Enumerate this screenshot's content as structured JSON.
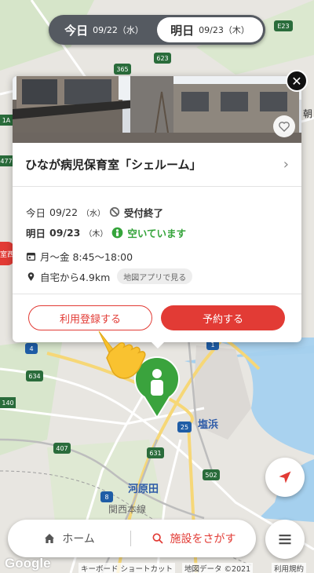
{
  "date_toggle": {
    "today_label": "今日",
    "today_date": "09/22（水）",
    "tomorrow_label": "明日",
    "tomorrow_date": "09/23（木）",
    "selected": "tomorrow"
  },
  "map_labels": {
    "route_365": "365",
    "route_623": "623",
    "route_e23": "E23",
    "route_477": "477",
    "route_4": "4",
    "route_1": "1",
    "route_634": "634",
    "route_140": "140",
    "route_407": "407",
    "route_25": "25",
    "route_631": "631",
    "route_502": "502",
    "route_8": "8",
    "route_1a": "1A",
    "place_shiohama": "塩浜",
    "place_kawaharada": "河原田",
    "place_kansai": "関西本線",
    "place_asa": "朝",
    "place_shitsu": "室西"
  },
  "facility": {
    "name": "ひなが病児保育室「シェルーム」",
    "today_prefix": "今日",
    "today_date": "09/22",
    "today_dow": "（水）",
    "today_status": "受付終了",
    "tomorrow_prefix": "明日",
    "tomorrow_date": "09/23",
    "tomorrow_dow": "（木）",
    "tomorrow_status": "空いています",
    "hours": "月〜金 8:45〜18:00",
    "distance": "自宅から4.9km",
    "map_app_label": "地図アプリで見る",
    "register_label": "利用登録する",
    "reserve_label": "予約する"
  },
  "icons": {
    "close": "close-icon",
    "heart": "heart-icon",
    "chevron": "chevron-right-icon",
    "closed": "ban-icon",
    "open": "person-icon",
    "calendar": "calendar-icon",
    "location": "pin-icon",
    "home": "home-icon",
    "search": "search-icon",
    "menu": "menu-icon",
    "locate": "navigation-icon"
  },
  "bottom_nav": {
    "home_label": "ホーム",
    "search_label": "施設をさがす"
  },
  "attribution": {
    "google": "Google",
    "shortcut": "キーボード ショートカット",
    "map_data": "地図データ ©2021",
    "terms": "利用規約"
  },
  "colors": {
    "accent_red": "#e23b35",
    "open_green": "#35a43b",
    "toggle_dark": "#555a61",
    "pin_green": "#3aa33d"
  }
}
